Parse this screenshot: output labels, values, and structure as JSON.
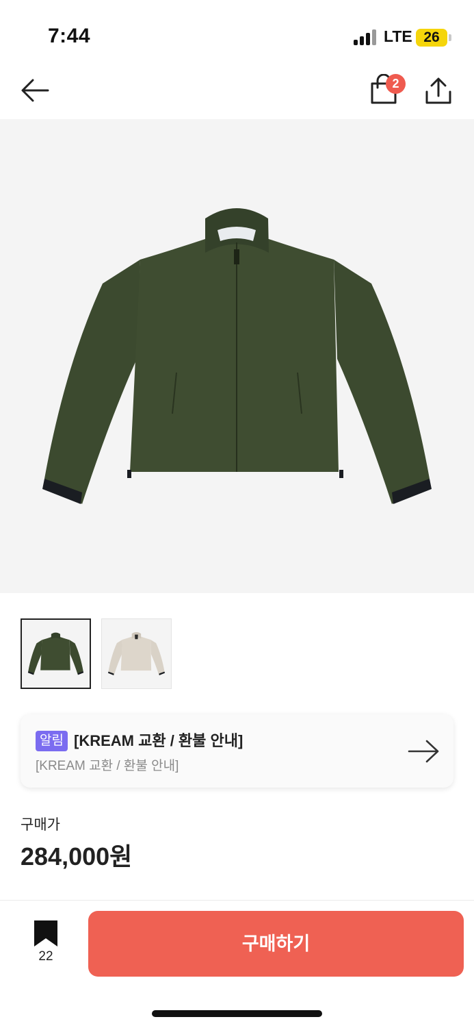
{
  "status_bar": {
    "time": "7:44",
    "network": "LTE",
    "battery": "26"
  },
  "nav": {
    "cart_count": "2",
    "icons": [
      "back-arrow-icon",
      "shopping-bag-icon",
      "share-icon"
    ]
  },
  "product": {
    "main_image": "olive-green-zip-jacket",
    "thumbnails": [
      "olive-green-zip-jacket",
      "beige-zip-jacket"
    ],
    "jacket_colors": {
      "green": "#3c4a2f",
      "beige": "#d9d2c7"
    }
  },
  "notice": {
    "badge": "알림",
    "title": "[KREAM 교환 / 환불 안내]",
    "subtitle": "[KREAM 교환 / 환불 안내]"
  },
  "price": {
    "label": "구매가",
    "value": "284,000원"
  },
  "bottom_bar": {
    "bookmark_count": "22",
    "buy_label": "구매하기"
  },
  "colors": {
    "accent": "#ef6153",
    "badge": "#7b6cf0",
    "cart_badge": "#ef5b4f"
  }
}
